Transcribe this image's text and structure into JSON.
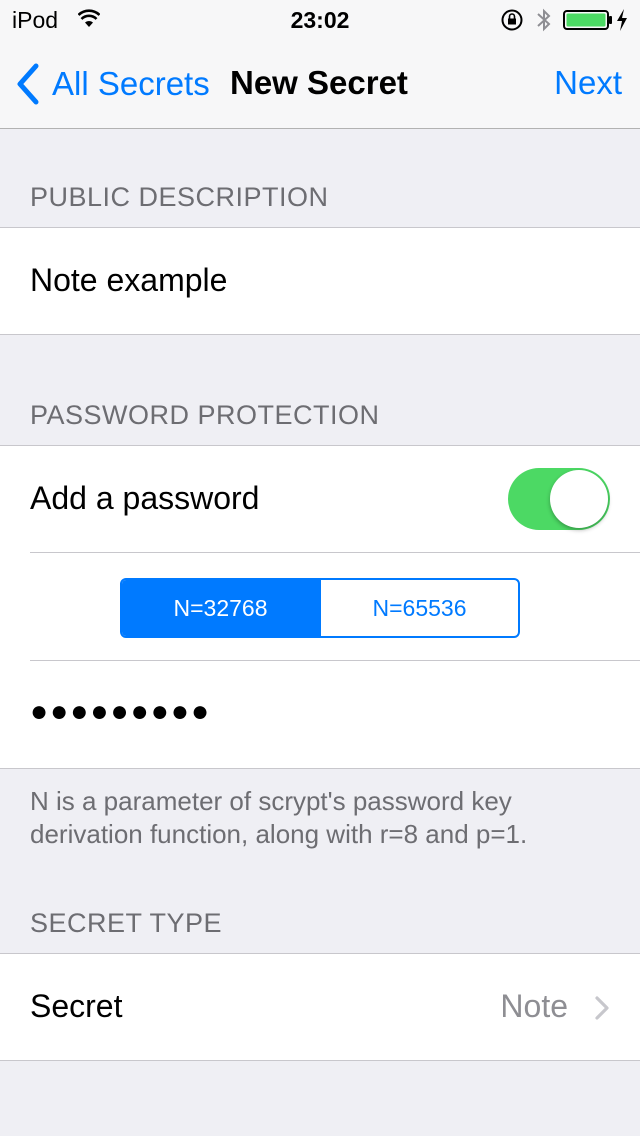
{
  "status_bar": {
    "carrier": "iPod",
    "time": "23:02",
    "wifi_icon": "wifi-icon",
    "lock_icon": "rotation-lock-icon",
    "bluetooth_icon": "bluetooth-icon",
    "battery_icon": "battery-icon",
    "charging_icon": "charging-bolt-icon",
    "battery_color": "#4cd964"
  },
  "nav": {
    "back_label": "All Secrets",
    "back_icon": "chevron-left-icon",
    "title": "New Secret",
    "next_label": "Next"
  },
  "sections": {
    "public_description": {
      "header": "PUBLIC DESCRIPTION",
      "value": "Note example"
    },
    "password_protection": {
      "header": "PASSWORD PROTECTION",
      "toggle_label": "Add a password",
      "toggle_on": true,
      "segments": [
        "N=32768",
        "N=65536"
      ],
      "selected_segment": "N=32768",
      "password_masked": "●●●●●●●●●",
      "footer": "N is a parameter of scrypt's password key derivation function, along with r=8 and p=1."
    },
    "secret_type": {
      "header": "SECRET TYPE",
      "label": "Secret",
      "value": "Note",
      "disclosure_icon": "chevron-right-icon"
    }
  },
  "colors": {
    "accent": "#007aff",
    "toggle_on": "#4cd964",
    "background": "#efeff4",
    "header_text": "#6d6d72",
    "detail_text": "#8e8e93"
  }
}
